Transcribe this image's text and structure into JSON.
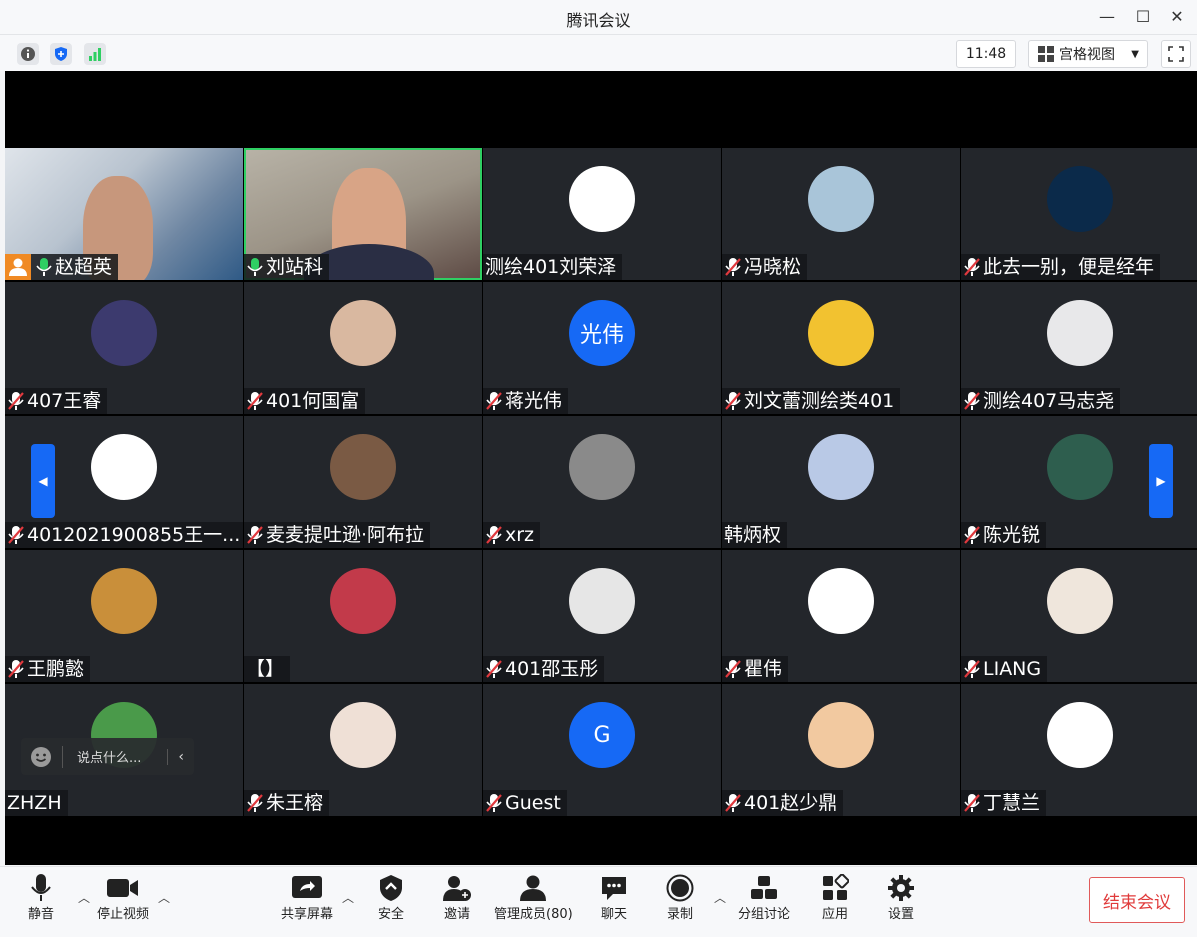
{
  "window": {
    "title": "腾讯会议"
  },
  "topbar": {
    "time": "11:48",
    "view_mode": "宫格视图"
  },
  "participants": [
    {
      "name": "赵超英",
      "mic": "on",
      "host": true,
      "kind": "video1"
    },
    {
      "name": "刘站科",
      "mic": "on",
      "kind": "video2"
    },
    {
      "name": "测绘401刘荣泽",
      "mic": "none",
      "kind": "avatar",
      "avatar_text": "",
      "avatar_bg": "#ffffff"
    },
    {
      "name": "冯晓松",
      "mic": "muted",
      "kind": "avatar",
      "avatar_text": "",
      "avatar_bg": "#a9c5d9"
    },
    {
      "name": "此去一别，便是经年",
      "mic": "muted",
      "kind": "avatar",
      "avatar_text": "",
      "avatar_bg": "#0b2a4a"
    },
    {
      "name": "407王睿",
      "mic": "muted",
      "kind": "avatar",
      "avatar_text": "",
      "avatar_bg": "#3c3a6e"
    },
    {
      "name": "401何国富",
      "mic": "muted",
      "kind": "avatar",
      "avatar_text": "",
      "avatar_bg": "#d9b8a0"
    },
    {
      "name": "蒋光伟",
      "mic": "muted",
      "kind": "avatar",
      "avatar_text": "光伟",
      "avatar_bg": "#1669f5"
    },
    {
      "name": "刘文蕾测绘类401",
      "mic": "muted",
      "kind": "avatar",
      "avatar_text": "",
      "avatar_bg": "#f2c230"
    },
    {
      "name": "测绘407马志尧",
      "mic": "muted",
      "kind": "avatar",
      "avatar_text": "",
      "avatar_bg": "#e8e8ea"
    },
    {
      "name": "4012021900855王一...",
      "mic": "muted",
      "kind": "avatar",
      "avatar_text": "",
      "avatar_bg": "#ffffff"
    },
    {
      "name": "麦麦提吐逊·阿布拉",
      "mic": "muted",
      "kind": "avatar",
      "avatar_text": "",
      "avatar_bg": "#7a5a44"
    },
    {
      "name": "xrz",
      "mic": "muted",
      "kind": "avatar",
      "avatar_text": "",
      "avatar_bg": "#8a8a8a"
    },
    {
      "name": "韩炳权",
      "mic": "none",
      "kind": "avatar",
      "avatar_text": "",
      "avatar_bg": "#b9c9e6"
    },
    {
      "name": "陈光锐",
      "mic": "muted",
      "kind": "avatar",
      "avatar_text": "",
      "avatar_bg": "#2e5e4e"
    },
    {
      "name": "王鹏懿",
      "mic": "muted",
      "kind": "avatar",
      "avatar_text": "",
      "avatar_bg": "#c98f3a"
    },
    {
      "name": "【】",
      "mic": "none",
      "kind": "avatar",
      "avatar_text": "",
      "avatar_bg": "#c23a4a"
    },
    {
      "name": "401邵玉彤",
      "mic": "muted",
      "kind": "avatar",
      "avatar_text": "",
      "avatar_bg": "#e6e6e6"
    },
    {
      "name": "瞿伟",
      "mic": "muted",
      "kind": "avatar",
      "avatar_text": "",
      "avatar_bg": "#ffffff"
    },
    {
      "name": "LIANG",
      "mic": "muted",
      "kind": "avatar",
      "avatar_text": "",
      "avatar_bg": "#efe6dc"
    },
    {
      "name": "ZHZH",
      "mic": "none",
      "kind": "avatar",
      "avatar_text": "",
      "avatar_bg": "#4a9a4a"
    },
    {
      "name": "朱王榕",
      "mic": "muted",
      "kind": "avatar",
      "avatar_text": "",
      "avatar_bg": "#efe0d6"
    },
    {
      "name": "Guest",
      "mic": "muted",
      "kind": "avatar",
      "avatar_text": "G",
      "avatar_bg": "#1669f5"
    },
    {
      "name": "401赵少鼎",
      "mic": "muted",
      "kind": "avatar",
      "avatar_text": "",
      "avatar_bg": "#f2c9a0"
    },
    {
      "name": "丁慧兰",
      "mic": "muted",
      "kind": "avatar",
      "avatar_text": "",
      "avatar_bg": "#ffffff"
    }
  ],
  "chat": {
    "placeholder": "说点什么..."
  },
  "toolbar": {
    "mute": "静音",
    "stop_video": "停止视频",
    "share": "共享屏幕",
    "security": "安全",
    "invite": "邀请",
    "members": "管理成员(80)",
    "chat": "聊天",
    "record": "录制",
    "breakout": "分组讨论",
    "apps": "应用",
    "settings": "设置",
    "end": "结束会议"
  },
  "colors": {
    "accent": "#1669f5",
    "end_red": "#e03b3b",
    "mic_green": "#2fcf63",
    "muted_red": "#e0393e"
  }
}
